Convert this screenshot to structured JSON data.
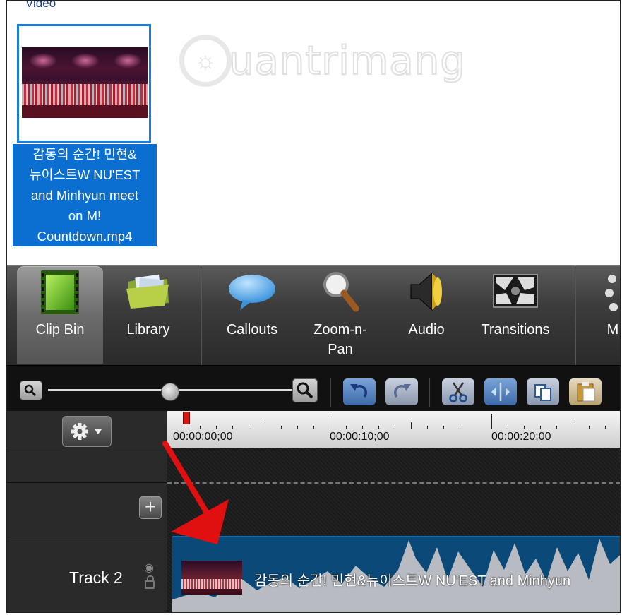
{
  "clip_bin": {
    "section_title": "Video",
    "clip": {
      "label": "감동의 순간! 민현&뉴이스트W NU'EST and Minhyun meet on M! Countdown.mp4",
      "label_lines": [
        "감동의 순간! 민현&",
        "뉴이스트W NU'EST",
        "and Minhyun meet",
        "on M!",
        "Countdown.mp4"
      ]
    },
    "watermark": "uantrimang"
  },
  "tabs": [
    {
      "label": "Clip Bin",
      "icon": "film-strip-icon",
      "active": true
    },
    {
      "label": "Library",
      "icon": "folder-icon",
      "active": false
    },
    {
      "label": "Callouts",
      "icon": "speech-bubble-icon",
      "active": false
    },
    {
      "label": "Zoom-n-\nPan",
      "label_lines": [
        "Zoom-n-",
        "Pan"
      ],
      "icon": "magnifier-icon",
      "active": false
    },
    {
      "label": "Audio",
      "icon": "speaker-icon",
      "active": false
    },
    {
      "label": "Transitions",
      "icon": "transition-icon",
      "active": false
    },
    {
      "label": "M",
      "icon": "more-icon",
      "active": false
    }
  ],
  "timeline": {
    "timecodes": [
      "00:00:00;00",
      "00:00:10;00",
      "00:00:20;00"
    ],
    "track": {
      "name": "Track 2",
      "clip_title": "감동의 순간! 민현&뉴이스트W NU'EST and Minhyun"
    }
  },
  "colors": {
    "selection": "#0a6fd0",
    "arrow": "#e01010",
    "clip_bar": "#0b4a78",
    "waveform": "#b8bcc2"
  }
}
